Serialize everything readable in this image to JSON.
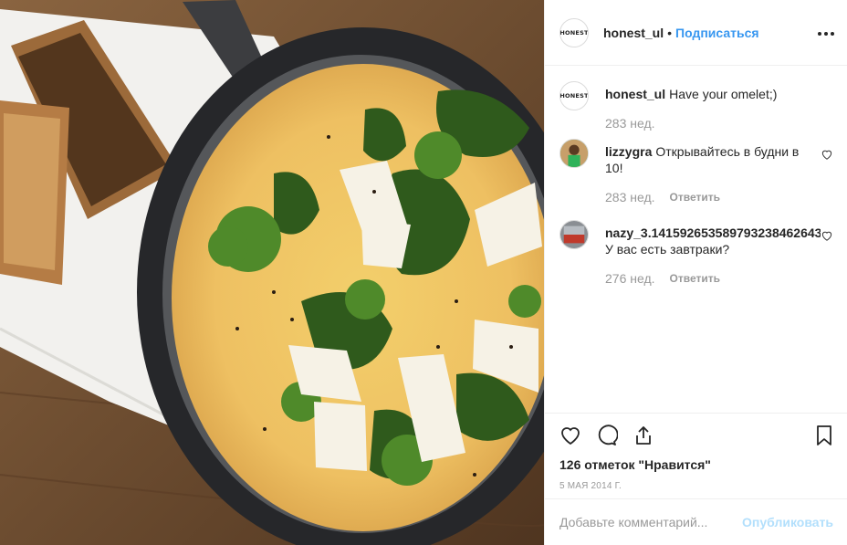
{
  "header": {
    "logo_text": "HONEST",
    "username": "honest_ul",
    "separator": "•",
    "follow_label": "Подписаться",
    "more_label": "•••"
  },
  "caption": {
    "logo_text": "HONEST",
    "username": "honest_ul",
    "text": "Have your omelet;)",
    "time": "283 нед."
  },
  "comments": [
    {
      "username": "lizzygra",
      "text": "Открывайтесь в будни в 10!",
      "time": "283 нед.",
      "reply_label": "Ответить"
    },
    {
      "username": "nazy_3.1415926535897932384626433",
      "text": "У вас есть завтраки?",
      "time": "276 нед.",
      "reply_label": "Ответить"
    }
  ],
  "actions": {
    "likes": "126 отметок \"Нравится\"",
    "date": "5 МАЯ 2014 Г."
  },
  "add_comment": {
    "placeholder": "Добавьте комментарий...",
    "publish_label": "Опубликовать"
  },
  "colors": {
    "accent": "#3897f0",
    "publish_disabled": "#b2dffc",
    "muted": "#999999",
    "text": "#262626"
  },
  "icons": [
    "more-icon",
    "heart-icon",
    "comment-icon",
    "share-icon",
    "bookmark-icon"
  ]
}
